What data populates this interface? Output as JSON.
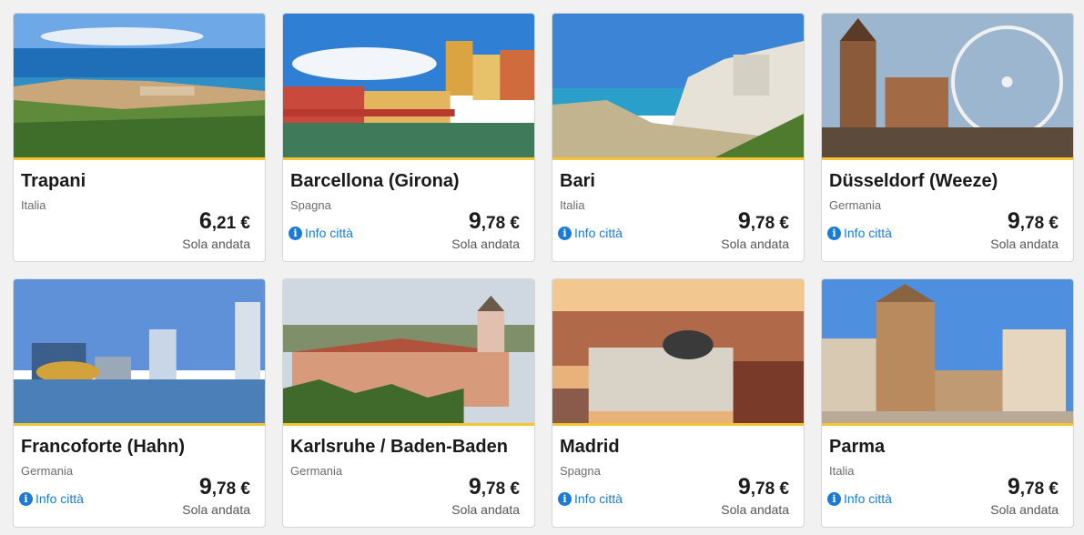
{
  "cards": [
    {
      "city": "Trapani",
      "country": "Italia",
      "info": "",
      "price_int": "6",
      "price_rest": ",21 €",
      "trip": "Sola andata",
      "image": "coastal-harbor-town"
    },
    {
      "city": "Barcellona (Girona)",
      "country": "Spagna",
      "info": "Info città",
      "price_int": "9",
      "price_rest": ",78 €",
      "trip": "Sola andata",
      "image": "colorful-riverside-houses"
    },
    {
      "city": "Bari",
      "country": "Italia",
      "info": "Info città",
      "price_int": "9",
      "price_rest": ",78 €",
      "trip": "Sola andata",
      "image": "cliffside-beach"
    },
    {
      "city": "Düsseldorf (Weeze)",
      "country": "Germania",
      "info": "Info città",
      "price_int": "9",
      "price_rest": ",78 €",
      "trip": "Sola andata",
      "image": "church-and-ferris-wheel"
    },
    {
      "city": "Francoforte (Hahn)",
      "country": "Germania",
      "info": "Info città",
      "price_int": "9",
      "price_rest": ",78 €",
      "trip": "Sola andata",
      "image": "city-skyline-river"
    },
    {
      "city": "Karlsruhe / Baden-Baden",
      "country": "Germania",
      "info": "",
      "price_int": "9",
      "price_rest": ",78 €",
      "trip": "Sola andata",
      "image": "historic-buildings"
    },
    {
      "city": "Madrid",
      "country": "Spagna",
      "info": "Info città",
      "price_int": "9",
      "price_rest": ",78 €",
      "trip": "Sola andata",
      "image": "sunset-city-buildings"
    },
    {
      "city": "Parma",
      "country": "Italia",
      "info": "Info città",
      "price_int": "9",
      "price_rest": ",78 €",
      "trip": "Sola andata",
      "image": "piazza-tower"
    }
  ],
  "colors": {
    "accent": "#f4c433",
    "link": "#1a7bd6",
    "info_icon": "info-icon"
  }
}
